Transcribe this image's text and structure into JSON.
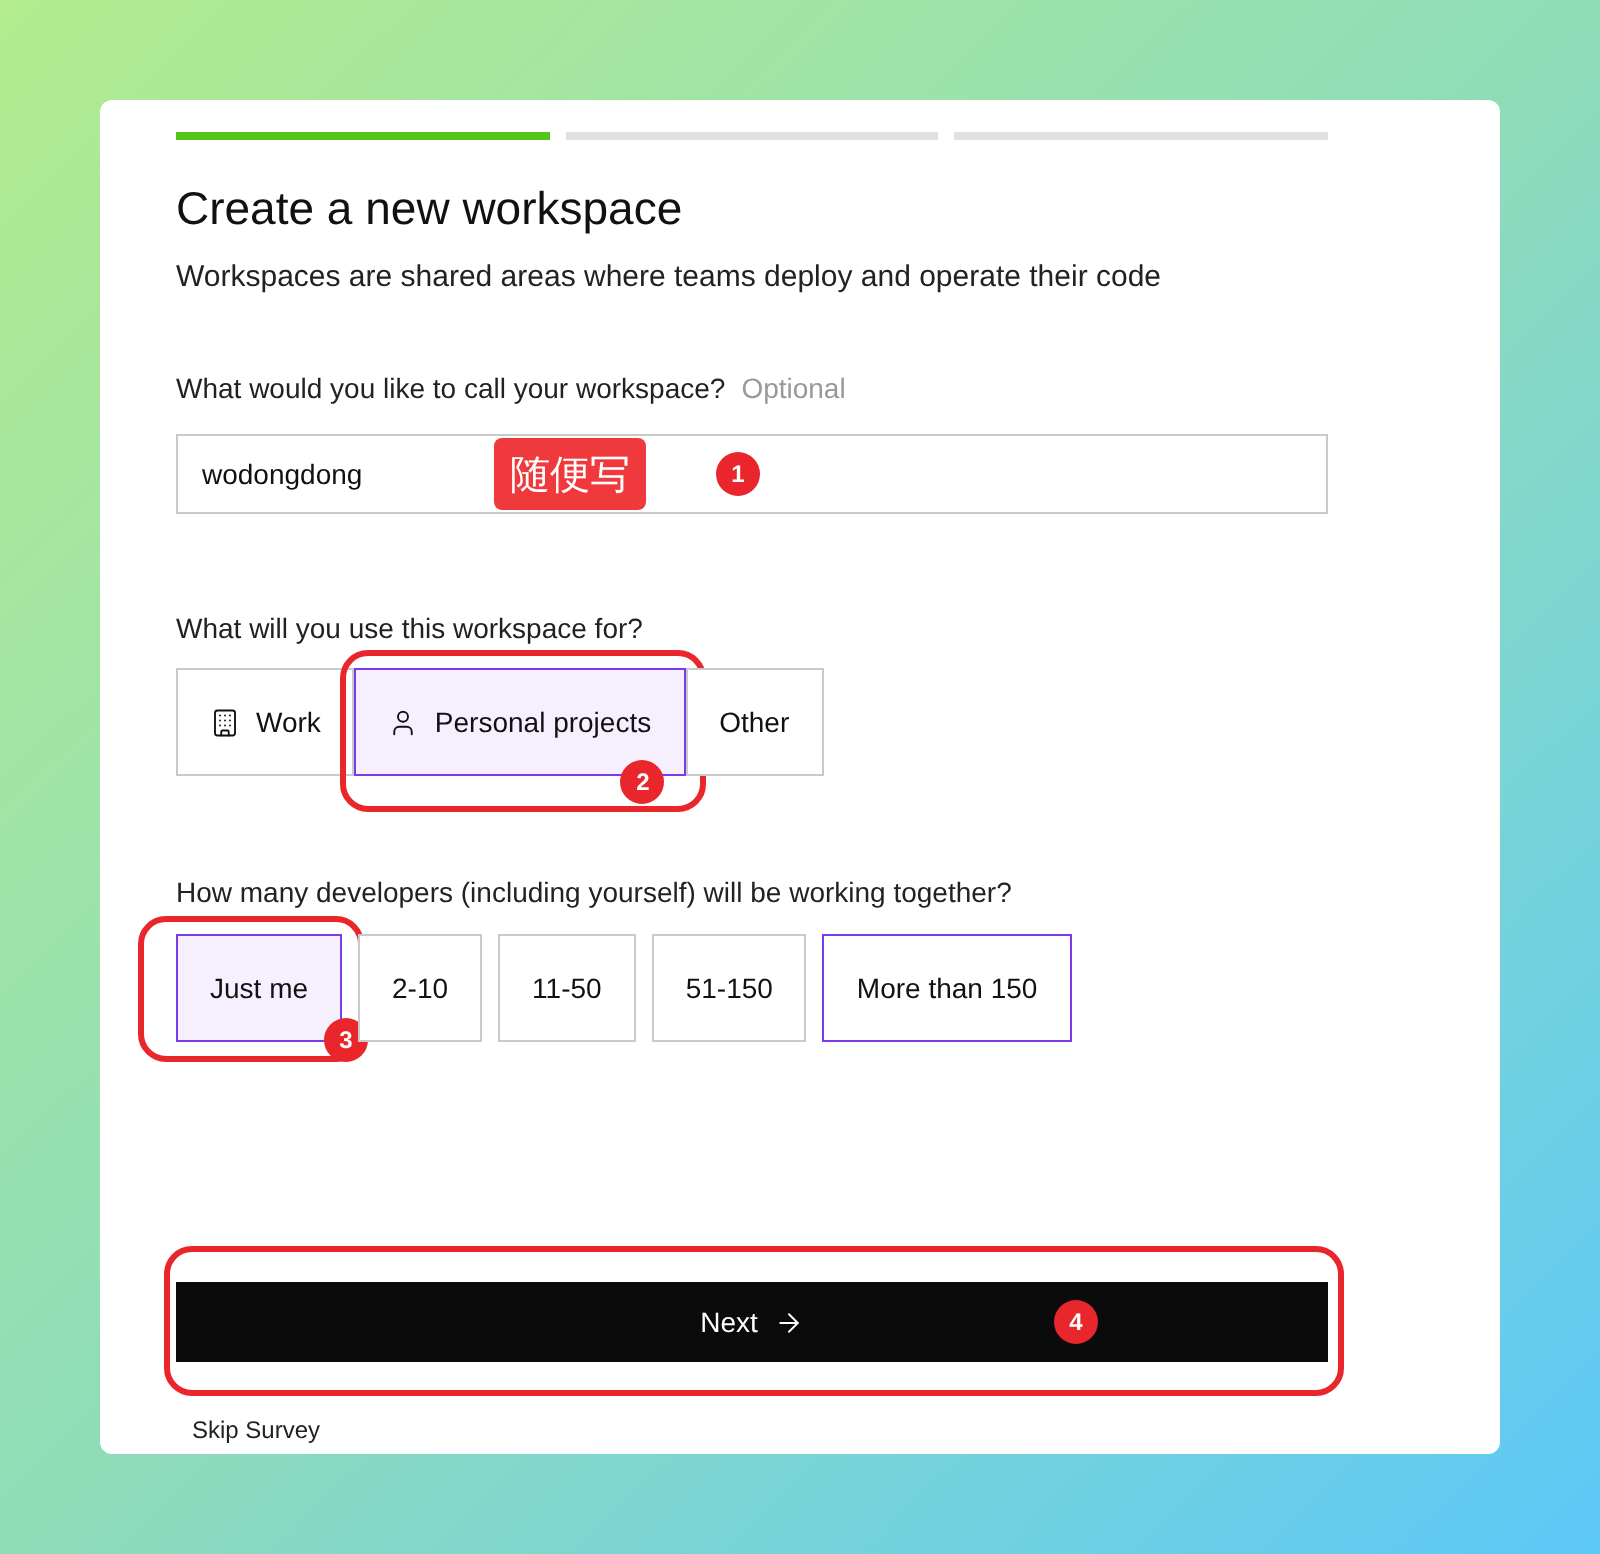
{
  "progress": [
    {
      "completed": true
    },
    {
      "completed": false
    },
    {
      "completed": false
    }
  ],
  "title": "Create a new workspace",
  "subtitle": "Workspaces are shared areas where teams deploy and operate their code",
  "name_field": {
    "label": "What would you like to call your workspace?",
    "hint": "Optional",
    "value": "wodongdong",
    "note": "随便写",
    "badge": "1"
  },
  "use_question": "What will you use this workspace for?",
  "use_options": [
    {
      "label": "Work",
      "kind": "building",
      "selected": false,
      "hovered": false
    },
    {
      "label": "Personal projects",
      "kind": "person",
      "selected": true,
      "hovered": false,
      "badge": "2"
    },
    {
      "label": "Other",
      "kind": "plain",
      "selected": false,
      "hovered": false
    }
  ],
  "size_question": "How many developers (including yourself) will be working together?",
  "size_options": [
    {
      "label": "Just me",
      "selected": true,
      "hovered": false,
      "badge": "3"
    },
    {
      "label": "2-10",
      "selected": false,
      "hovered": false
    },
    {
      "label": "11-50",
      "selected": false,
      "hovered": false
    },
    {
      "label": "51-150",
      "selected": false,
      "hovered": false
    },
    {
      "label": "More than 150",
      "selected": false,
      "hovered": true
    }
  ],
  "next_button": {
    "label": "Next",
    "badge": "4"
  },
  "skip_link": "Skip Survey"
}
